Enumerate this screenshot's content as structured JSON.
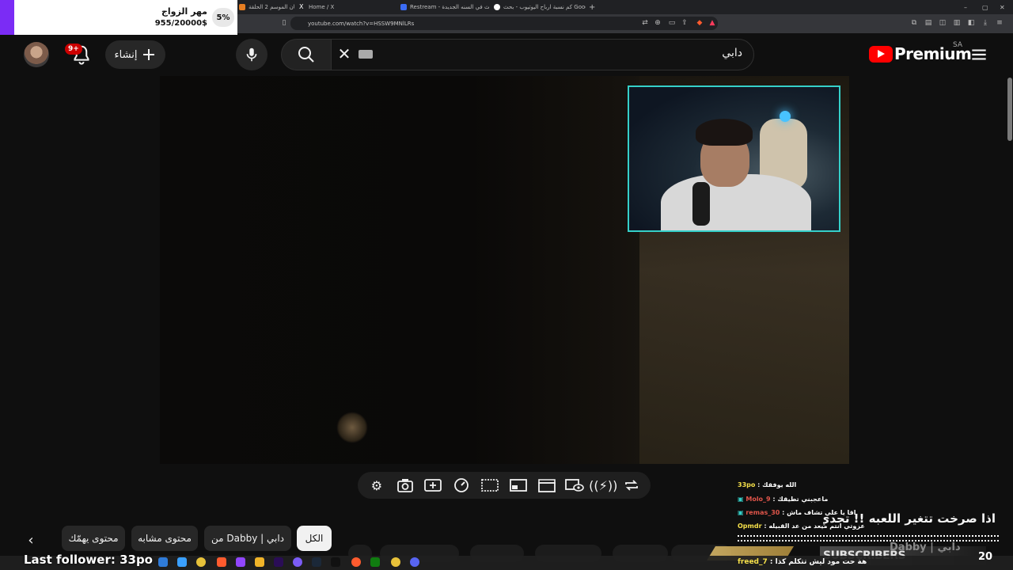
{
  "browser": {
    "tabs": [
      {
        "label": "جاكي شان الموسم 2 الحلقة",
        "color": "#e67e22"
      },
      {
        "label": "Home / X",
        "color": "#ffffff"
      },
      {
        "label": "Restream - اول بث في السنه الجديدة",
        "color": "#3b6cf6"
      },
      {
        "label": "كم نسبة ارباح اليوتيوب - بحث Google",
        "color": "#ffffff"
      }
    ],
    "new_tab": "+",
    "url": "youtube.com/watch?v=HSSW9MNlLRs",
    "window_controls": [
      "–",
      "▢",
      "✕"
    ]
  },
  "goal": {
    "title": "مهر الزواج",
    "amount": "955/20000$",
    "percent": "5%",
    "accent": "#7b2cf5"
  },
  "youtube": {
    "create_label": "إنشاء",
    "notifications_badge": "9+",
    "search_query": "دابي",
    "logo_text": "Premium",
    "region": "SA",
    "icons": [
      "avatar",
      "bell-icon",
      "plus-icon",
      "mic-icon",
      "search-icon",
      "close-icon",
      "keyboard-icon",
      "menu-icon"
    ]
  },
  "player_tools": [
    "settings-icon",
    "screenshot-icon",
    "enhance-icon",
    "speed-icon",
    "cinema-icon",
    "pip-icon",
    "clapper-icon",
    "watch-icon",
    "stream-icon",
    "loop-icon"
  ],
  "chips": {
    "all": "الكل",
    "from_channel": "من Dabby | دابي",
    "related": "محتوى مشابه",
    "interests": "محتوى يهمّك"
  },
  "chat": [
    {
      "user": "33po",
      "message": "الله يوفقك"
    },
    {
      "user": "Molo_9",
      "message": "ماعجبني تطيقك"
    },
    {
      "user": "remas_30",
      "message": "اقا يا علي تشاف ماش"
    },
    {
      "user": "Opmdr",
      "message": "عزوتي انتم ميعد من عد القبيله"
    }
  ],
  "announcement": "اذا صرخت تتغير اللعبه !! تحدي الرعب",
  "chat_bottom": {
    "user": "freed_7",
    "message": "هة حت مود ليش تتكلم كذا"
  },
  "overlay": {
    "subscribers_label": "SUBSCRIBERS",
    "channel": "Dabby | دابي",
    "subscribers_count": "20",
    "last_follower": "Last follower: 33po"
  },
  "taskbar": {
    "icons": [
      "edge-icon",
      "store-icon",
      "chrome-icon",
      "brave-icon",
      "twitch-icon",
      "files-icon",
      "premiere-icon",
      "obs-icon",
      "steam-icon",
      "terminal-icon",
      "brave2-icon",
      "xbox-icon",
      "chrome2-icon",
      "discord-icon"
    ]
  }
}
